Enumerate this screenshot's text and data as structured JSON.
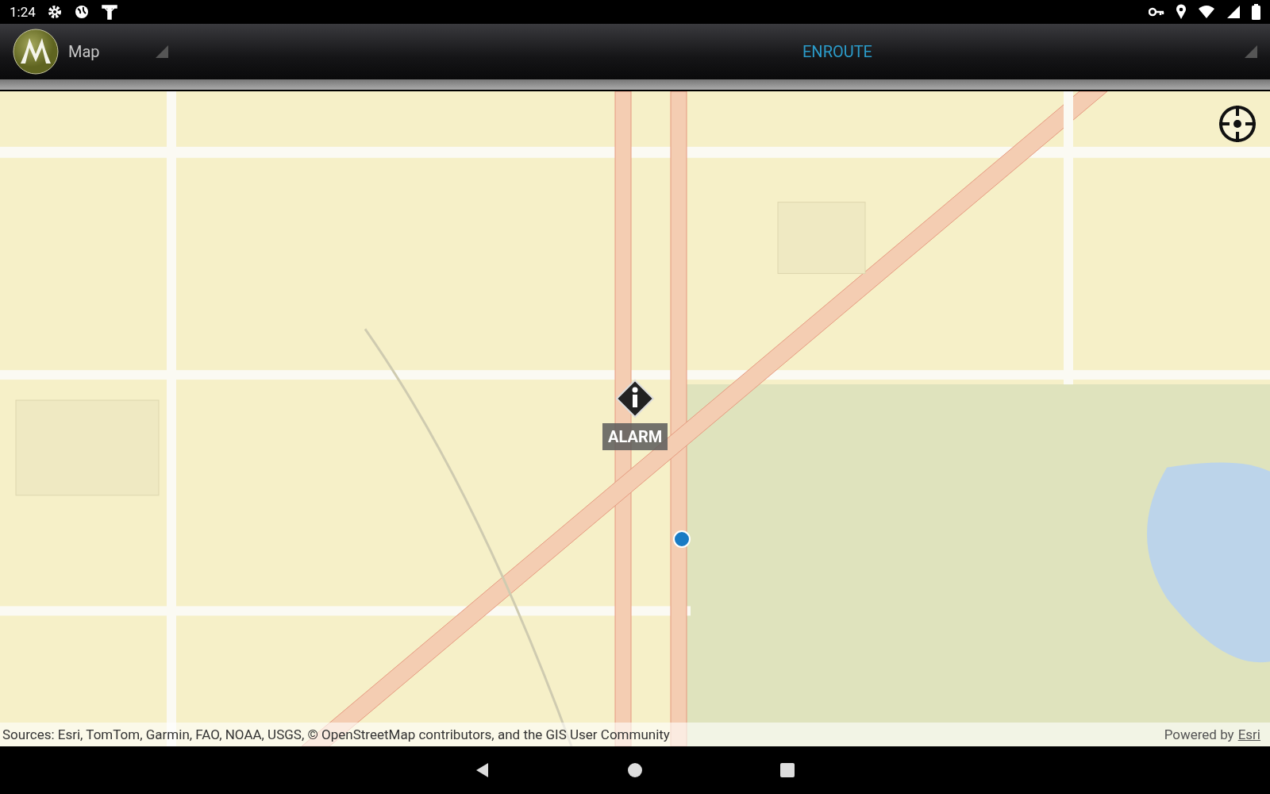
{
  "status_bar": {
    "time": "1:24"
  },
  "app_bar": {
    "title": "Map",
    "status": "ENROUTE"
  },
  "map": {
    "kind": "picture",
    "markers": [
      {
        "kind": "incident",
        "label": "ALARM"
      },
      {
        "kind": "location"
      }
    ]
  },
  "attribution": {
    "sources": "Sources: Esri, TomTom, Garmin, FAO, NOAA, USGS, © OpenStreetMap contributors, and the GIS User Community",
    "powered_by": "Powered by",
    "link": "Esri"
  }
}
